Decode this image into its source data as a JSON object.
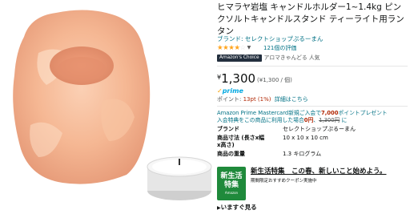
{
  "product": {
    "title": "ヒマラヤ岩塩 キャンドルホルダー1~1.4kg ピンクソルトキャンドルスタンド ティーライト用ランタン",
    "brand_line": "ブランド: セレクトショップぷるーまん",
    "rating": {
      "stars_filled": "★★★★",
      "stars_empty": "☆",
      "value": 4,
      "count_text": "121個の評価"
    },
    "choice": {
      "badge": "Amazon's Choice",
      "text": "アロマきゃんどる 人気"
    },
    "price": {
      "symbol": "¥",
      "amount": "1,300",
      "unit": "(¥1,300 / 個)"
    },
    "prime": "prime",
    "points": {
      "label": "ポイント: ",
      "value": "13pt (1%)",
      "link": "詳細はこちら"
    },
    "promo": {
      "prefix": "Amazon Prime Mastercard新規ご入会で",
      "amount": "7,000",
      "suffix": "ポイントプレゼント",
      "line2_prefix": "入会特典をこの商品に利用した場合",
      "zero_price": "0円",
      "strike_price": "1,300円",
      "line2_suffix": "に"
    },
    "specs": [
      {
        "label": "ブランド",
        "value": "セレクトショップぷるーまん"
      },
      {
        "label": "商品寸法 (長さx幅x高さ)",
        "value": "10 x 10 x 10 cm"
      },
      {
        "label": "商品の重量",
        "value": "1.3 キログラム"
      }
    ],
    "banner": {
      "badge_line1": "新生活",
      "badge_line2": "特集",
      "badge_line3": "Amazon",
      "main_text": "新生活特集　この春、新しいこと始めよう。",
      "sub_text": "期間限定おすすめクーポン実施中"
    },
    "see_now": "いますぐ見る"
  },
  "colors": {
    "link": "#007185",
    "price_red": "#b12704",
    "star": "#ffa41c",
    "choice_bg": "#232f3e",
    "banner_green": "#1f8a3b"
  }
}
